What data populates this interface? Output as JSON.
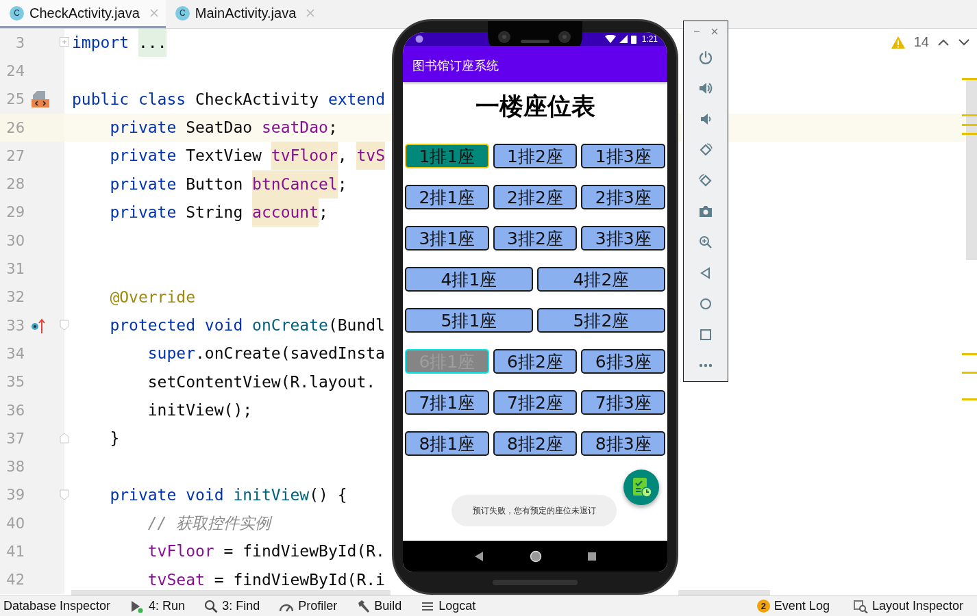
{
  "tabs": [
    {
      "label": "CheckActivity.java",
      "icon_letter": "C",
      "selected": true
    },
    {
      "label": "MainActivity.java",
      "icon_letter": "C",
      "selected": false
    }
  ],
  "editor": {
    "warnings": "14",
    "lines": [
      {
        "number": "3",
        "current": false,
        "tokens": [
          {
            "kind": "kw",
            "text": "import "
          },
          {
            "kind": "folded",
            "text": "..."
          }
        ]
      },
      {
        "number": "24",
        "current": false
      },
      {
        "number": "25",
        "current": false,
        "tokens": [
          {
            "kind": "kw",
            "text": "public class"
          },
          {
            "kind": "plain",
            "text": " CheckActivity "
          },
          {
            "kind": "kw",
            "text": "extend"
          }
        ]
      },
      {
        "number": "26",
        "current": true,
        "tokens": [
          {
            "kind": "kw",
            "text": "    private"
          },
          {
            "kind": "plain",
            "text": " SeatDao "
          },
          {
            "kind": "field",
            "text": "seatDao"
          },
          {
            "kind": "plain",
            "text": ";"
          }
        ]
      },
      {
        "number": "27",
        "current": false,
        "tokens": [
          {
            "kind": "kw",
            "text": "    private"
          },
          {
            "kind": "plain",
            "text": " TextView "
          },
          {
            "kind": "field-hl",
            "text": "tvFloor"
          },
          {
            "kind": "plain",
            "text": ", "
          },
          {
            "kind": "field-hl",
            "text": "tvS"
          }
        ]
      },
      {
        "number": "28",
        "current": false,
        "tokens": [
          {
            "kind": "kw",
            "text": "    private"
          },
          {
            "kind": "plain",
            "text": " Button "
          },
          {
            "kind": "field-hl",
            "text": "btnCancel"
          },
          {
            "kind": "plain",
            "text": ";"
          }
        ]
      },
      {
        "number": "29",
        "current": false,
        "tokens": [
          {
            "kind": "kw",
            "text": "    private"
          },
          {
            "kind": "plain",
            "text": " String "
          },
          {
            "kind": "field-hl",
            "text": "account"
          },
          {
            "kind": "plain",
            "text": ";"
          }
        ]
      },
      {
        "number": "30",
        "current": false
      },
      {
        "number": "31",
        "current": false
      },
      {
        "number": "32",
        "current": false,
        "tokens": [
          {
            "kind": "annotation",
            "text": "    @Override"
          }
        ]
      },
      {
        "number": "33",
        "current": false,
        "tokens": [
          {
            "kind": "kw",
            "text": "    protected void"
          },
          {
            "kind": "method",
            "text": " onCreate"
          },
          {
            "kind": "plain",
            "text": "(Bundl"
          }
        ]
      },
      {
        "number": "34",
        "current": false,
        "tokens": [
          {
            "kind": "kw",
            "text": "        super"
          },
          {
            "kind": "plain",
            "text": ".onCreate(savedInsta"
          }
        ]
      },
      {
        "number": "35",
        "current": false,
        "tokens": [
          {
            "kind": "plain",
            "text": "        setContentView(R.layout."
          }
        ]
      },
      {
        "number": "36",
        "current": false,
        "tokens": [
          {
            "kind": "plain",
            "text": "        initView();"
          }
        ]
      },
      {
        "number": "37",
        "current": false,
        "tokens": [
          {
            "kind": "plain",
            "text": "    }"
          }
        ]
      },
      {
        "number": "38",
        "current": false
      },
      {
        "number": "39",
        "current": false,
        "tokens": [
          {
            "kind": "kw",
            "text": "    private void"
          },
          {
            "kind": "method",
            "text": " initView"
          },
          {
            "kind": "plain",
            "text": "() {"
          }
        ]
      },
      {
        "number": "40",
        "current": false,
        "tokens": [
          {
            "kind": "comment",
            "text": "        // 获取控件实例"
          }
        ]
      },
      {
        "number": "41",
        "current": false,
        "tokens": [
          {
            "kind": "field",
            "text": "        tvFloor"
          },
          {
            "kind": "plain",
            "text": " = findViewById(R."
          }
        ]
      },
      {
        "number": "42",
        "current": false,
        "tokens": [
          {
            "kind": "field",
            "text": "        tvSeat"
          },
          {
            "kind": "plain",
            "text": " = findViewById(R.i"
          }
        ]
      }
    ]
  },
  "phone": {
    "time": "1:21",
    "app_title": "图书馆订座系统",
    "heading": "一楼座位表",
    "seat_rows": [
      {
        "seats": [
          {
            "label": "1排1座",
            "selected": true,
            "disabled": false
          },
          {
            "label": "1排2座",
            "selected": false,
            "disabled": false
          },
          {
            "label": "1排3座",
            "selected": false,
            "disabled": false
          }
        ]
      },
      {
        "seats": [
          {
            "label": "2排1座",
            "selected": false,
            "disabled": false
          },
          {
            "label": "2排2座",
            "selected": false,
            "disabled": false
          },
          {
            "label": "2排3座",
            "selected": false,
            "disabled": false
          }
        ]
      },
      {
        "seats": [
          {
            "label": "3排1座",
            "selected": false,
            "disabled": false
          },
          {
            "label": "3排2座",
            "selected": false,
            "disabled": false
          },
          {
            "label": "3排3座",
            "selected": false,
            "disabled": false
          }
        ]
      },
      {
        "seats": [
          {
            "label": "4排1座",
            "selected": false,
            "disabled": false
          },
          {
            "label": "4排2座",
            "selected": false,
            "disabled": false
          }
        ]
      },
      {
        "seats": [
          {
            "label": "5排1座",
            "selected": false,
            "disabled": false
          },
          {
            "label": "5排2座",
            "selected": false,
            "disabled": false
          }
        ]
      },
      {
        "seats": [
          {
            "label": "6排1座",
            "selected": false,
            "disabled": true
          },
          {
            "label": "6排2座",
            "selected": false,
            "disabled": false
          },
          {
            "label": "6排3座",
            "selected": false,
            "disabled": false
          }
        ]
      },
      {
        "seats": [
          {
            "label": "7排1座",
            "selected": false,
            "disabled": false
          },
          {
            "label": "7排2座",
            "selected": false,
            "disabled": false
          },
          {
            "label": "7排3座",
            "selected": false,
            "disabled": false
          }
        ]
      },
      {
        "seats": [
          {
            "label": "8排1座",
            "selected": false,
            "disabled": false
          },
          {
            "label": "8排2座",
            "selected": false,
            "disabled": false
          },
          {
            "label": "8排3座",
            "selected": false,
            "disabled": false
          }
        ]
      }
    ],
    "toast": "预订失败，您有预定的座位未退订"
  },
  "status_bar": {
    "left": [
      {
        "label": "Database Inspector"
      },
      {
        "label": "4: Run"
      },
      {
        "label": "3: Find"
      },
      {
        "label": "Profiler"
      },
      {
        "label": "Build"
      },
      {
        "label": "Logcat"
      }
    ],
    "right": [
      {
        "label": "Event Log",
        "badge": "2"
      },
      {
        "label": "Layout Inspector"
      }
    ]
  }
}
